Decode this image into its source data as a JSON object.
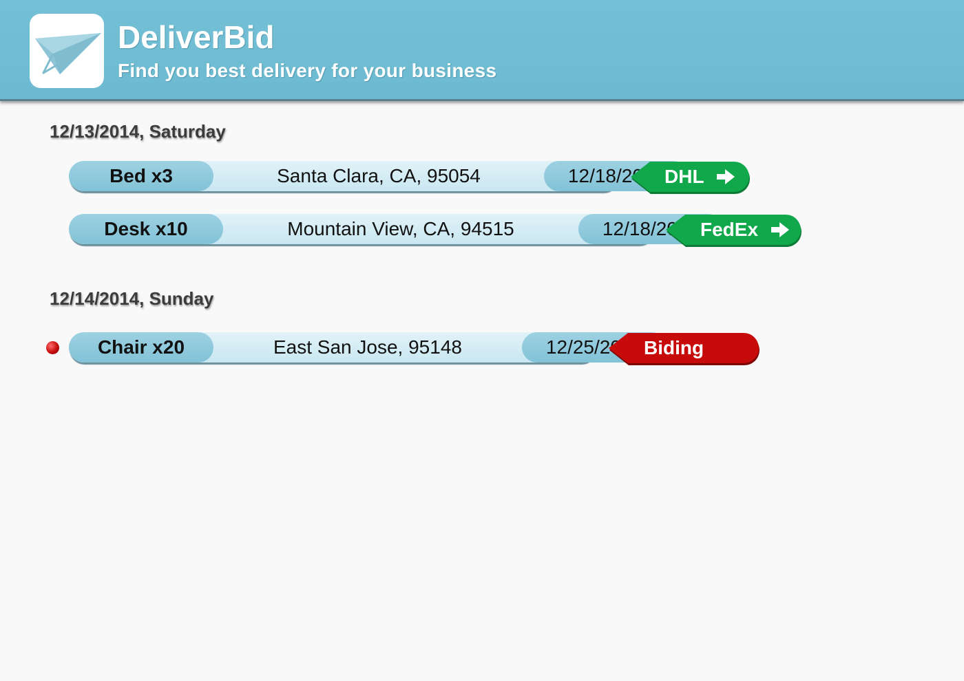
{
  "app": {
    "title": "DeliverBid",
    "subtitle": "Find you best delivery for your business",
    "logo_icon": "paper-plane-icon"
  },
  "colors": {
    "header": "#72bfd5",
    "pill_dark": "#8fc9dc",
    "pill_light": "#d6eef6",
    "carrier_green": "#10a84a",
    "bidding_red": "#c70b0b"
  },
  "groups": [
    {
      "heading": "12/13/2014, Saturday",
      "orders": [
        {
          "item": "Bed x3",
          "location": "Santa Clara, CA, 95054",
          "date": "12/18/2014",
          "status": {
            "label": "DHL",
            "kind": "carrier",
            "icon": "arrow-right-icon",
            "color": "#10a84a"
          }
        },
        {
          "item": "Desk x10",
          "location": "Mountain View, CA, 94515",
          "date": "12/18/2014",
          "status": {
            "label": "FedEx",
            "kind": "carrier",
            "icon": "arrow-right-icon",
            "color": "#10a84a"
          }
        }
      ]
    },
    {
      "heading": "12/14/2014, Sunday",
      "orders": [
        {
          "item": "Chair x20",
          "location": "East San Jose, 95148",
          "date": "12/25/2014",
          "status": {
            "label": "Biding",
            "kind": "bidding",
            "color": "#c70b0b"
          },
          "marker": "red-dot"
        }
      ]
    }
  ]
}
